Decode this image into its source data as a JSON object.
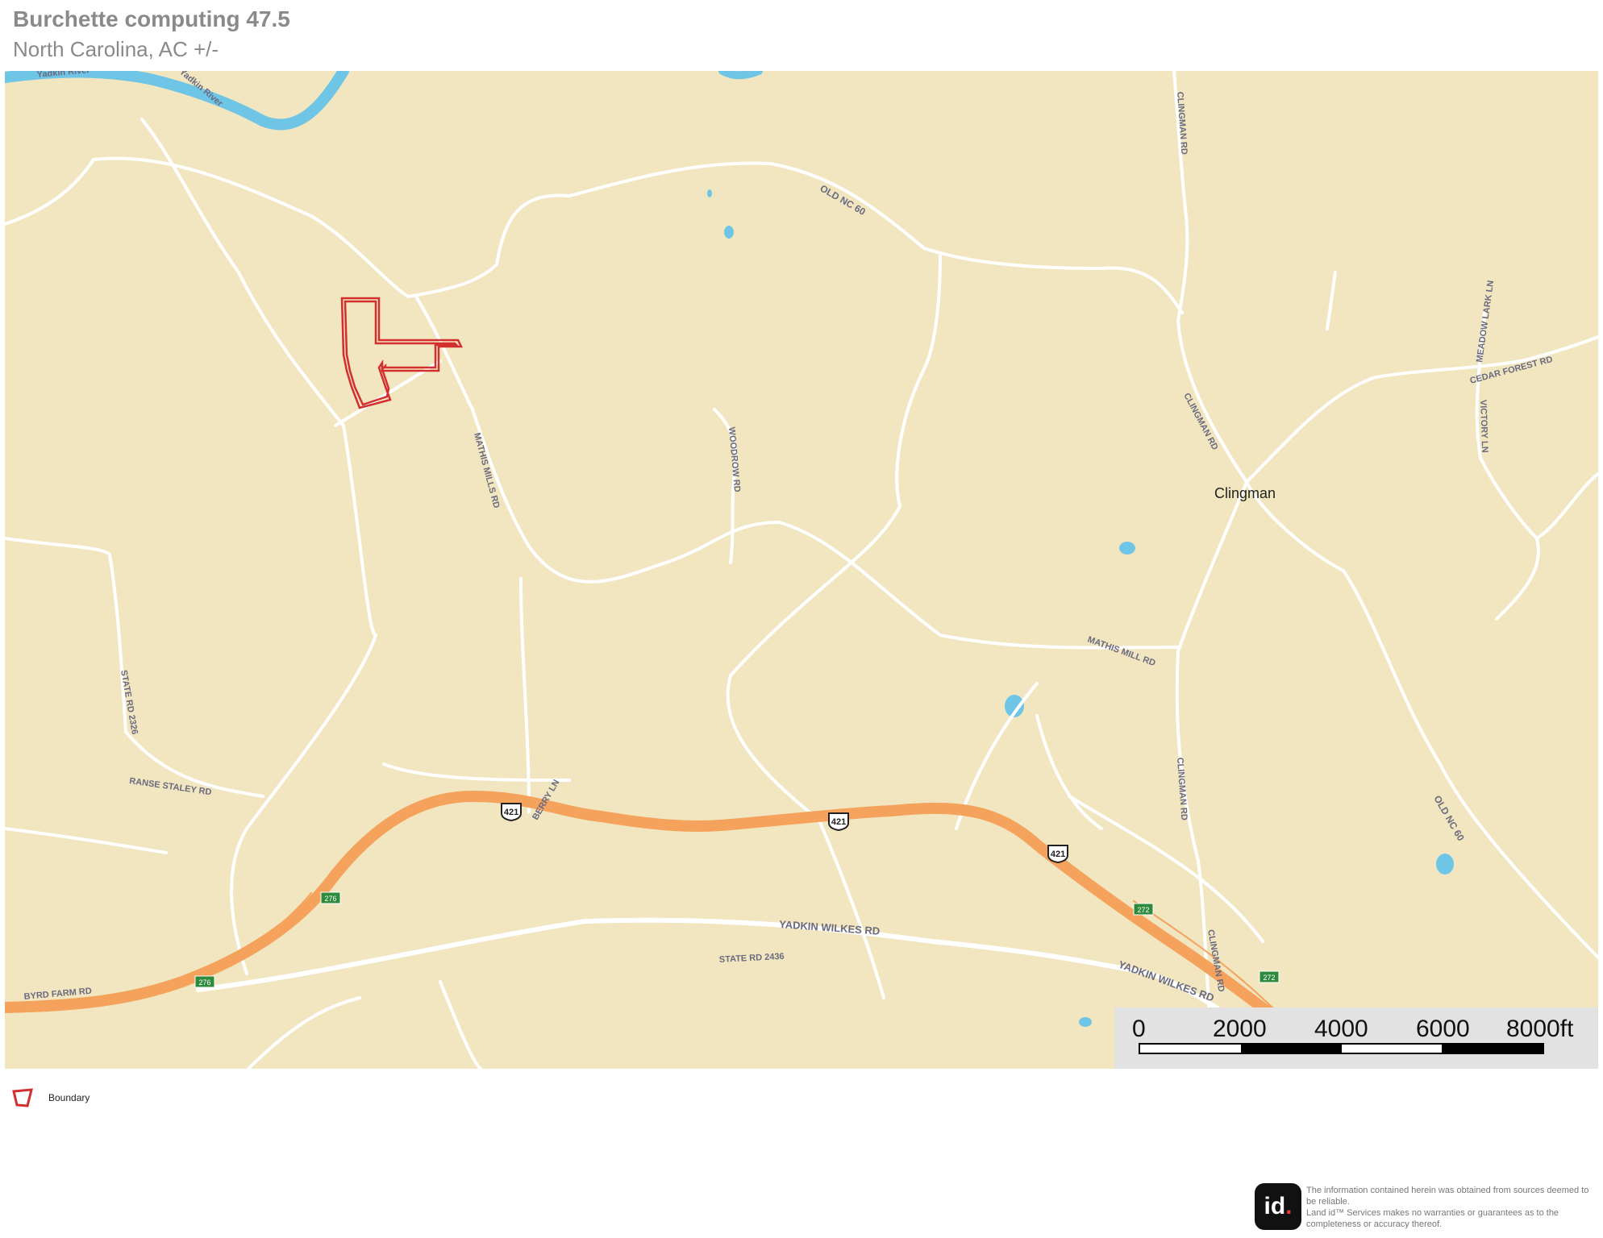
{
  "header": {
    "title": "Burchette computing 47.5",
    "subtitle": "North Carolina,  AC +/-"
  },
  "map": {
    "colors": {
      "land": "#f1e6bf",
      "water": "#6fc5e6",
      "road": "#ffffff",
      "highway": "#f5a25d",
      "boundary": "#d32f2f",
      "shield_green": "#2e8b3e"
    },
    "labels": {
      "river1": "Yadkin River",
      "river2": "Yadkin River",
      "old_nc60_a": "OLD NC 60",
      "old_nc60_b": "OLD NC 60",
      "clingman_rd_a": "CLINGMAN RD",
      "clingman_rd_b": "CLINGMAN RD",
      "clingman_rd_c": "CLINGMAN RD",
      "clingman_rd_d": "CLINGMAN RD",
      "meadow_lark": "MEADOW LARK LN",
      "cedar_forest": "CEDAR FOREST RD",
      "victory": "VICTORY LN",
      "mathis_mills": "MATHIS MILLS RD",
      "woodrow": "WOODROW RD",
      "mathis_mill": "MATHIS MILL RD",
      "state_rd_2326": "STATE RD 2326",
      "ranse_staley": "RANSE STALEY RD",
      "berry_ln": "BERRY LN",
      "yadkin_wilkes_a": "YADKIN WILKES RD",
      "yadkin_wilkes_b": "YADKIN WILKES RD",
      "state_rd_2436": "STATE RD 2436",
      "byrd_farm": "BYRD FARM RD",
      "town": "Clingman",
      "us421": "421",
      "nc276": "276",
      "nc272": "272"
    },
    "scale": {
      "ticks": [
        "0",
        "2000",
        "4000",
        "6000",
        "8000ft"
      ]
    }
  },
  "legend": {
    "items": [
      {
        "label": "Boundary",
        "icon": "boundary-polygon-icon"
      }
    ]
  },
  "footer": {
    "logo_text": "id",
    "logo_dot": ".",
    "disclaimer": "The information contained herein was obtained from sources deemed to be reliable.\n Land id™ Services makes no warranties or guarantees as to the completeness or accuracy thereof."
  }
}
